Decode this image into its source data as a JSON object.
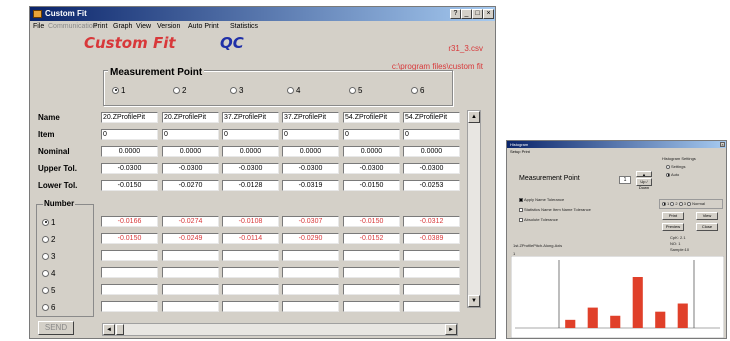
{
  "main_window": {
    "title": "Custom Fit",
    "controls": [
      "?",
      "_",
      "□",
      "×"
    ],
    "menu": [
      "File",
      "Communication",
      "Print",
      "Graph",
      "View",
      "Version",
      "Auto Print",
      "Statistics"
    ],
    "app_title": "Custom Fit",
    "mode": "QC",
    "file_name": "r31_3.csv",
    "file_path": "c:\\program files\\custom fit",
    "measurement_point": {
      "label": "Measurement Point",
      "options": [
        "1",
        "2",
        "3",
        "4",
        "5",
        "6"
      ],
      "selected": 0
    },
    "row_labels": {
      "name": "Name",
      "item": "Item",
      "nominal": "Nominal",
      "upper": "Upper Tol.",
      "lower": "Lower Tol."
    },
    "columns": [
      {
        "name": "20.ZProfilePit",
        "item": "0",
        "nominal": "0.0000",
        "upper": "-0.0300",
        "lower": "-0.0150",
        "values": [
          "-0.0166",
          "-0.0150",
          "",
          "",
          "",
          ""
        ]
      },
      {
        "name": "20.ZProfilePit",
        "item": "0",
        "nominal": "0.0000",
        "upper": "-0.0300",
        "lower": "-0.0270",
        "values": [
          "-0.0274",
          "-0.0249",
          "",
          "",
          "",
          ""
        ]
      },
      {
        "name": "37.ZProfilePit",
        "item": "0",
        "nominal": "0.0000",
        "upper": "-0.0300",
        "lower": "-0.0128",
        "values": [
          "-0.0108",
          "-0.0114",
          "",
          "",
          "",
          ""
        ]
      },
      {
        "name": "37.ZProfilePit",
        "item": "0",
        "nominal": "0.0000",
        "upper": "-0.0300",
        "lower": "-0.0319",
        "values": [
          "-0.0307",
          "-0.0290",
          "",
          "",
          "",
          ""
        ]
      },
      {
        "name": "54.ZProfilePit",
        "item": "0",
        "nominal": "0.0000",
        "upper": "-0.0300",
        "lower": "-0.0150",
        "values": [
          "-0.0150",
          "-0.0152",
          "",
          "",
          "",
          ""
        ]
      },
      {
        "name": "54.ZProfilePit",
        "item": "0",
        "nominal": "0.0000",
        "upper": "-0.0300",
        "lower": "-0.0253",
        "values": [
          "-0.0312",
          "-0.0389",
          "",
          "",
          "",
          ""
        ]
      }
    ],
    "number": {
      "label": "Number",
      "options": [
        "1",
        "2",
        "3",
        "4",
        "5",
        "6"
      ],
      "selected": 0
    },
    "send_label": "SEND"
  },
  "histogram_window": {
    "title": "Histogram",
    "menu": "Setup Print",
    "settings_label": "Histogram Settings",
    "settings_options": [
      "Settings",
      "Auto"
    ],
    "settings_selected": 1,
    "measurement_point_label": "Measurement Point",
    "measurement_point_value": "1",
    "button_labels": {
      "up_down": "Up / Down",
      "print": "Print",
      "view": "View",
      "preview": "Preview",
      "close": "Close"
    },
    "checkboxes": [
      "Apply Name Tolerance",
      "Statistics Name Item Name Tolerance",
      "Absolute Tolerance"
    ],
    "display_options": [
      "1",
      "2",
      "3",
      "Normal"
    ],
    "stats_lines": [
      "CpK: 2.1",
      "NO: 1",
      "Sample:10"
    ],
    "series_label": "1st.ZProfilePitch.Along.Axis",
    "series_index": "1"
  },
  "colors": {
    "accent_red": "#d8383a",
    "mode_blue": "#2030a8",
    "bar": "#e0402a",
    "window_face": "#d4d0c8",
    "title_gradient_start": "#0a246a"
  },
  "chart_data": {
    "type": "bar",
    "categories": [
      "",
      "",
      "",
      "",
      "",
      ""
    ],
    "values": [
      0.12,
      0.3,
      0.18,
      0.75,
      0.24,
      0.36
    ],
    "ylim": [
      0,
      1
    ],
    "limit_line_labels": [
      "",
      ""
    ],
    "grid": false,
    "legend": "none"
  }
}
